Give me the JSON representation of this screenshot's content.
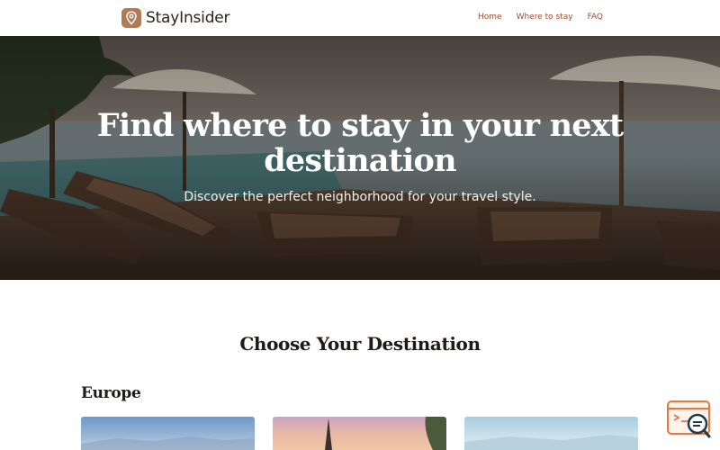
{
  "header": {
    "brand_name": "StayInsider",
    "logo_icon": "map-pin-icon",
    "nav": [
      "Home",
      "Where to stay",
      "FAQ"
    ]
  },
  "hero": {
    "title": "Find where to stay in your next destination",
    "subtitle": "Discover the perfect neighborhood for your travel style."
  },
  "main": {
    "section_title": "Choose Your Destination",
    "regions": [
      {
        "name": "Europe"
      }
    ]
  },
  "colors": {
    "brand": "#b07a57",
    "nav_link": "#a04b2f"
  }
}
